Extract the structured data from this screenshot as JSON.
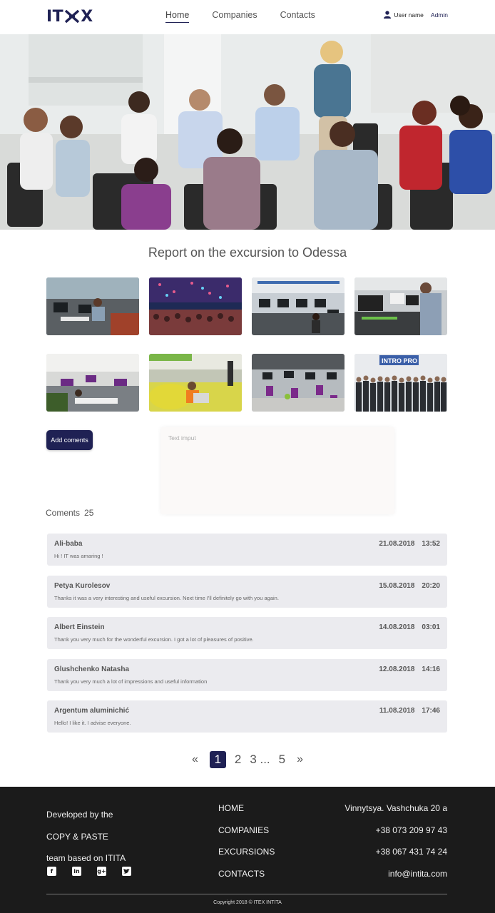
{
  "header": {
    "logo": "ITEX",
    "nav": [
      {
        "label": "Home",
        "active": true
      },
      {
        "label": "Companies",
        "active": false
      },
      {
        "label": "Contacts",
        "active": false
      }
    ],
    "user_name": "User name",
    "admin_label": "Admin"
  },
  "hero": {
    "image": "group-meeting-photo"
  },
  "page_title": "Report on the excursion to Odessa",
  "gallery": [
    {
      "image": "open-office-photo-1"
    },
    {
      "image": "event-hall-lights-photo"
    },
    {
      "image": "office-workstations-photo"
    },
    {
      "image": "developer-at-desk-photo"
    },
    {
      "image": "purple-chairs-office-photo"
    },
    {
      "image": "beanbag-lounge-photo"
    },
    {
      "image": "office-desks-photo"
    },
    {
      "image": "intropro-team-photo",
      "sign": "INTRO PRO"
    }
  ],
  "comment_form": {
    "add_button": "Add coments",
    "input_placeholder": "Text imput"
  },
  "comments_header": {
    "label": "Coments",
    "count": "25"
  },
  "comments": [
    {
      "author": "Ali-baba",
      "date": "21.08.2018",
      "time": "13:52",
      "text": "Hi ! IT was amaring !"
    },
    {
      "author": "Petya Kurolesov",
      "date": "15.08.2018",
      "time": "20:20",
      "text": "Thanks it was a very interesting and useful excursion. Next time I'll definitely go with you again."
    },
    {
      "author": "Albert Einstein",
      "date": "14.08.2018",
      "time": "03:01",
      "text": "Thank you very much for the wonderful excursion. I got a lot of pleasures of positive."
    },
    {
      "author": "Glushchenko Natasha",
      "date": "12.08.2018",
      "time": "14:16",
      "text": "Thank you very much a lot of impressions and useful information"
    },
    {
      "author": "Argentum aluminichić",
      "date": "11.08.2018",
      "time": "17:46",
      "text": "Hello! I like it. I advise everyone."
    }
  ],
  "pagination": {
    "prev": "«",
    "pages": [
      "1",
      "2",
      "3 ...",
      "5"
    ],
    "active_page": "1",
    "next": "»"
  },
  "footer": {
    "about": [
      "Developed by the",
      "COPY & PASTE",
      "team based on ITITA"
    ],
    "socials": [
      "facebook",
      "linkedin",
      "google-plus",
      "twitter"
    ],
    "links": [
      "HOME",
      "COMPANIES",
      "EXCURSIONS",
      "CONTACTS"
    ],
    "contacts": [
      "Vinnytsya. Vashchuka 20 a",
      "+38 073 209 97 43",
      "+38 067 431 74 24",
      "info@intita.com"
    ],
    "copyright": "Copyright 2018 © ITEX INTITA"
  },
  "colors": {
    "brand": "#1f2154",
    "comment_bg": "#ebebef",
    "footer_bg": "#1b1b1b"
  }
}
